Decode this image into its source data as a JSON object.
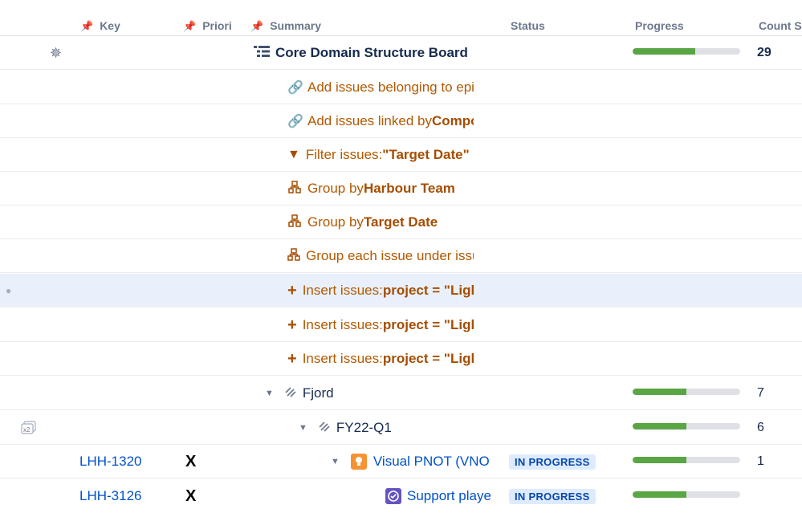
{
  "columns": {
    "key": "Key",
    "priority": "Priori",
    "summary": "Summary",
    "status": "Status",
    "progress": "Progress",
    "count": "Count S"
  },
  "top": {
    "title": "Core Domain Structure Board",
    "progress": 0.58,
    "count": "29"
  },
  "generators": [
    {
      "kind": "link",
      "prefix": "Add issues belonging to epic",
      "bold": ""
    },
    {
      "kind": "link",
      "prefix": "Add issues linked by ",
      "bold": "Compos"
    },
    {
      "kind": "filter",
      "prefix": "Filter issues: ",
      "bold": "\"Target Date\" ="
    },
    {
      "kind": "group",
      "prefix": "Group by ",
      "bold": "Harbour Team"
    },
    {
      "kind": "group",
      "prefix": "Group by ",
      "bold": "Target Date"
    },
    {
      "kind": "group",
      "prefix": "Group each issue under issue",
      "bold": ""
    },
    {
      "kind": "insert",
      "prefix": "Insert issues: ",
      "bold": "project = \"Ligh"
    },
    {
      "kind": "insert",
      "prefix": "Insert issues: ",
      "bold": "project = \"Ligh"
    },
    {
      "kind": "insert",
      "prefix": "Insert issues: ",
      "bold": "project = \"Ligh"
    }
  ],
  "groups": [
    {
      "name": "Fjord",
      "progress": 0.5,
      "count": "7"
    },
    {
      "name": "FY22-Q1",
      "progress": 0.5,
      "count": "6"
    }
  ],
  "issues": [
    {
      "key": "LHH-1320",
      "priority": "X",
      "summary": "Visual PNOT (VNO",
      "status": "IN PROGRESS",
      "progress": 0.5,
      "count": "1"
    },
    {
      "key": "LHH-3126",
      "priority": "X",
      "summary": "Support playe",
      "status": "IN PROGRESS",
      "progress": 0.5,
      "count": ""
    }
  ],
  "icons": {
    "magic": "magic-wand-icon",
    "structure": "structure-icon",
    "link": "link-icon",
    "filter": "filter-icon",
    "group": "group-icon",
    "insert": "insert-icon",
    "folder": "folder-icon",
    "x2": "x2-icon",
    "epic": "lightbulb-icon",
    "story": "check-circle-icon"
  },
  "colors": {
    "generator": "#a64d00",
    "link": "#0052cc",
    "progress_fill": "#5aa544",
    "status_bg": "#deebff",
    "highlight": "#e9f0fc"
  }
}
